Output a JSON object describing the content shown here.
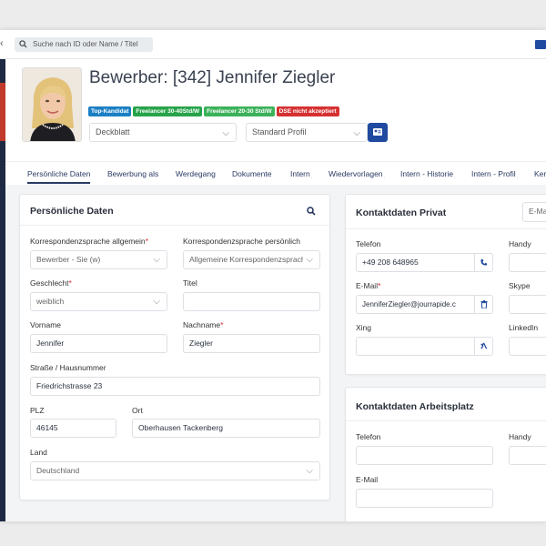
{
  "topbar": {
    "back": "‹",
    "search_placeholder": "Suche nach ID oder Name / Titel"
  },
  "header": {
    "title": "Bewerber: [342] Jennifer Ziegler",
    "badges": [
      {
        "label": "Top-Kandidat",
        "color": "#1b7fc4"
      },
      {
        "label": "Freelancer 30-40Std/W",
        "color": "#27a34a"
      },
      {
        "label": "Freelancer 20-30 Std/W",
        "color": "#3bb25a"
      },
      {
        "label": "DSE nicht akzeptiert",
        "color": "#d63031"
      }
    ],
    "select_left": "Deckblatt",
    "select_right": "Standard Profil",
    "chevron": "⌵"
  },
  "tabs": [
    "Persönliche Daten",
    "Bewerbung als",
    "Werdegang",
    "Dokumente",
    "Intern",
    "Wiedervorlagen",
    "Intern - Historie",
    "Intern - Profil",
    "Ker"
  ],
  "personal": {
    "title": "Persönliche Daten",
    "korr_allg_label": "Korrespondenzsprache allgemein",
    "korr_allg_value": "Bewerber - Sie (w)",
    "korr_pers_label": "Korrespondenzsprache persönlich",
    "korr_pers_value": "Allgemeine Korrespondenzsprache",
    "geschlecht_label": "Geschlecht",
    "geschlecht_value": "weiblich",
    "titel_label": "Titel",
    "titel_value": "",
    "vorname_label": "Vorname",
    "vorname_value": "Jennifer",
    "nachname_label": "Nachname",
    "nachname_value": "Ziegler",
    "strasse_label": "Straße / Hausnummer",
    "strasse_value": "Friedrichstrasse 23",
    "plz_label": "PLZ",
    "plz_value": "46145",
    "ort_label": "Ort",
    "ort_value": "Oberhausen Tackenberg",
    "land_label": "Land",
    "land_value": "Deutschland",
    "required_mark": "*"
  },
  "kontakt_privat": {
    "title": "Kontaktdaten Privat",
    "dropdown": "E-Ma",
    "telefon_label": "Telefon",
    "telefon_value": "+49 208 648965",
    "handy_label": "Handy",
    "email_label": "E-Mail",
    "email_value": "JenniferZiegler@jourrapide.c",
    "skype_label": "Skype",
    "xing_label": "Xing",
    "linkedin_label": "LinkedIn"
  },
  "kontakt_arbeit": {
    "title": "Kontaktdaten Arbeitsplatz",
    "telefon_label": "Telefon",
    "handy_label": "Handy",
    "email_label": "E-Mail"
  },
  "icons": {
    "search": "search-icon",
    "phone": "phone-icon",
    "trash": "trash-icon",
    "xing": "xing-icon",
    "card": "id-card-icon"
  }
}
